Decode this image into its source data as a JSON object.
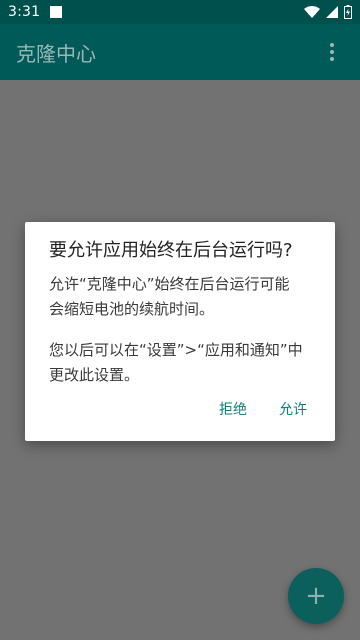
{
  "status_bar": {
    "time": "3:31"
  },
  "app_bar": {
    "title": "克隆中心"
  },
  "dialog": {
    "title": "要允许应用始终在后台运行吗?",
    "body_line1": "允许“克隆中心”始终在后台运行可能",
    "body_line2": "会缩短电池的续航时间。",
    "body_line3": "您以后可以在“设置”>“应用和通知”中",
    "body_line4": "更改此设置。",
    "deny_label": "拒绝",
    "allow_label": "允许"
  },
  "fab": {
    "icon": "+"
  },
  "colors": {
    "status_bar": "#00504d",
    "app_bar": "#005a57",
    "scrim": "#727272",
    "accent": "#0b7f79"
  }
}
